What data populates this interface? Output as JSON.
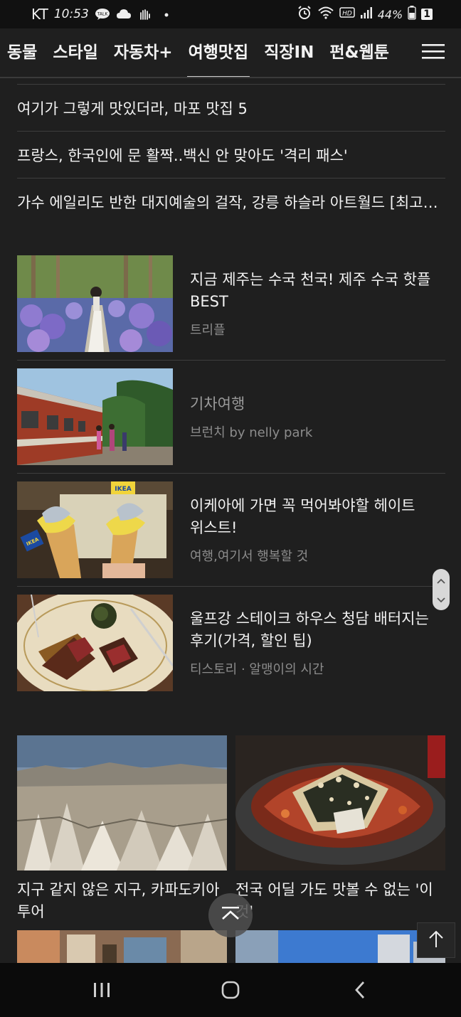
{
  "status_bar": {
    "carrier": "KT",
    "time": "10:53",
    "battery": "44%",
    "sim_badge": "1",
    "icons": [
      "talk-icon",
      "cloud-icon",
      "hand-icon",
      "dot-icon",
      "alarm-icon",
      "wifi-icon",
      "hd-icon",
      "signal-icon",
      "battery-icon"
    ]
  },
  "categories": [
    {
      "label": "동물"
    },
    {
      "label": "스타일"
    },
    {
      "label": "자동차+"
    },
    {
      "label": "여행맛집",
      "active": true
    },
    {
      "label": "직장IN"
    },
    {
      "label": "펀&웹툰"
    }
  ],
  "headlines": [
    "여기가 그렇게 맛있더라, 마포 맛집 5",
    "프랑스, 한국인에 문 활짝..백신 안 맞아도 '격리 패스'",
    "가수 에일리도 반한 대지예술의 걸작, 강릉 하슬라 아트월드 [최고의 여행지]"
  ],
  "articles": [
    {
      "title": "지금 제주는 수국 천국! 제주 수국 핫플 BEST",
      "source": "트리플"
    },
    {
      "title": "기차여행",
      "source": "브런치 by nelly park"
    },
    {
      "title": "이케아에 가면 꼭 먹어봐야할 헤이트 위스트!",
      "source": "여행,여기서 행복할 것"
    },
    {
      "title": "울프강 스테이크 하우스 청담 배터지는 후기(가격, 할인 팁)",
      "source": "티스토리 · 알맹이의 시간"
    }
  ],
  "cards": [
    {
      "title": "지구 같지 않은 지구, 카파도키아 투어"
    },
    {
      "title": "전국 어딜 가도 맛볼 수 없는 '이것'"
    }
  ],
  "colors": {
    "background": "#1f1f1f",
    "text": "#f2f2f2",
    "muted_text": "#8c8c8c",
    "divider": "#3e3e3e"
  }
}
